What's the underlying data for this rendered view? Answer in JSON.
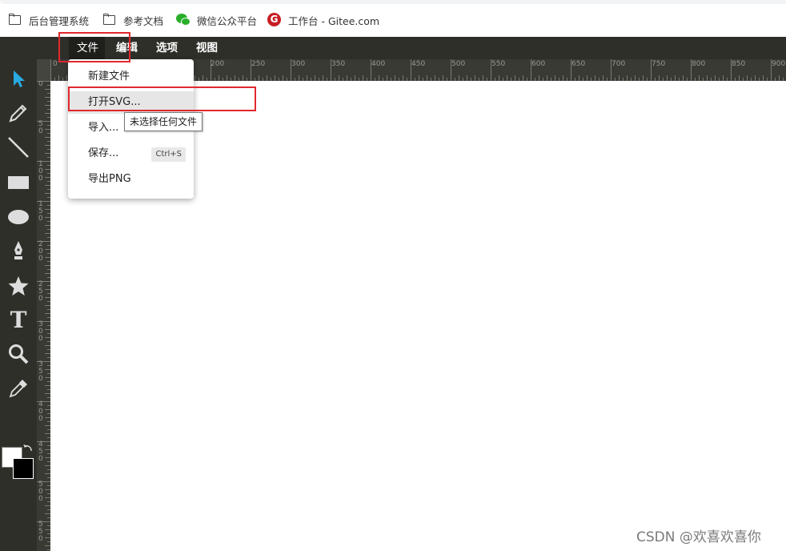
{
  "bookmarks": [
    {
      "icon": "folder-icon",
      "label": "后台管理系统"
    },
    {
      "icon": "folder-icon",
      "label": "参考文档"
    },
    {
      "icon": "wechat-icon",
      "label": "微信公众平台"
    },
    {
      "icon": "gitee-icon",
      "label": "工作台 - Gitee.com"
    }
  ],
  "menubar": {
    "items": [
      {
        "label": "文件"
      },
      {
        "label": "编辑"
      },
      {
        "label": "选项"
      },
      {
        "label": "视图"
      }
    ]
  },
  "file_menu": {
    "items": [
      {
        "label": "新建文件"
      },
      {
        "label": "打开SVG..."
      },
      {
        "label": "导入..."
      },
      {
        "label": "保存...",
        "shortcut": "Ctrl+S"
      },
      {
        "label": "导出PNG"
      }
    ]
  },
  "tooltip": {
    "text": "未选择任何文件"
  },
  "tools": [
    "select-arrow-icon",
    "pencil-icon",
    "line-icon",
    "rectangle-icon",
    "ellipse-icon",
    "pen-icon",
    "star-icon",
    "text-icon",
    "zoom-icon",
    "eyedropper-icon"
  ],
  "tool_text_glyph": "T",
  "rulers": {
    "top_labels": [
      "0",
      "200",
      "250",
      "300",
      "350",
      "400",
      "450",
      "500",
      "550",
      "600",
      "650",
      "700",
      "750",
      "800",
      "850",
      "900"
    ],
    "left_labels": [
      "0",
      "5 0",
      "1 0 0",
      "1 5 0",
      "2 0 0",
      "2 5 0",
      "3 0 0",
      "3 5 0",
      "4 0 0",
      "4 5 0",
      "5 0 0",
      "5 5 0"
    ]
  },
  "colors": {
    "accent": "#29aae1",
    "app_bg": "#2f2f2a",
    "highlight": "#e0282e",
    "fill_swatch": "#ffffff",
    "stroke_swatch": "#000000"
  },
  "watermark": "CSDN @欢喜欢喜你"
}
